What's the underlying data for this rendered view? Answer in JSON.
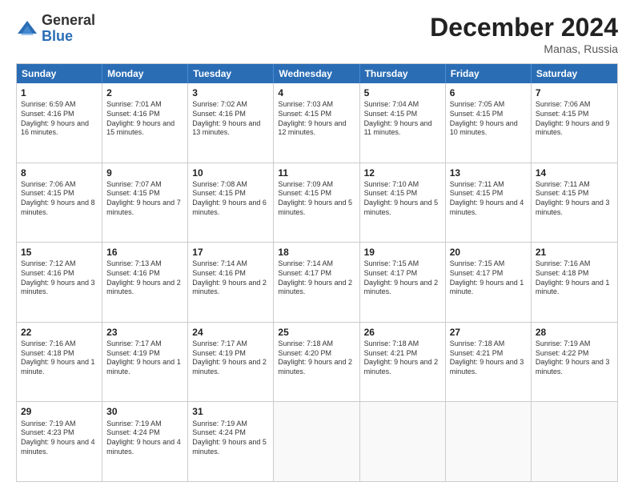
{
  "logo": {
    "general": "General",
    "blue": "Blue"
  },
  "title": "December 2024",
  "location": "Manas, Russia",
  "header_days": [
    "Sunday",
    "Monday",
    "Tuesday",
    "Wednesday",
    "Thursday",
    "Friday",
    "Saturday"
  ],
  "weeks": [
    [
      {
        "day": "1",
        "sunrise": "Sunrise: 6:59 AM",
        "sunset": "Sunset: 4:16 PM",
        "daylight": "Daylight: 9 hours and 16 minutes."
      },
      {
        "day": "2",
        "sunrise": "Sunrise: 7:01 AM",
        "sunset": "Sunset: 4:16 PM",
        "daylight": "Daylight: 9 hours and 15 minutes."
      },
      {
        "day": "3",
        "sunrise": "Sunrise: 7:02 AM",
        "sunset": "Sunset: 4:16 PM",
        "daylight": "Daylight: 9 hours and 13 minutes."
      },
      {
        "day": "4",
        "sunrise": "Sunrise: 7:03 AM",
        "sunset": "Sunset: 4:15 PM",
        "daylight": "Daylight: 9 hours and 12 minutes."
      },
      {
        "day": "5",
        "sunrise": "Sunrise: 7:04 AM",
        "sunset": "Sunset: 4:15 PM",
        "daylight": "Daylight: 9 hours and 11 minutes."
      },
      {
        "day": "6",
        "sunrise": "Sunrise: 7:05 AM",
        "sunset": "Sunset: 4:15 PM",
        "daylight": "Daylight: 9 hours and 10 minutes."
      },
      {
        "day": "7",
        "sunrise": "Sunrise: 7:06 AM",
        "sunset": "Sunset: 4:15 PM",
        "daylight": "Daylight: 9 hours and 9 minutes."
      }
    ],
    [
      {
        "day": "8",
        "sunrise": "Sunrise: 7:06 AM",
        "sunset": "Sunset: 4:15 PM",
        "daylight": "Daylight: 9 hours and 8 minutes."
      },
      {
        "day": "9",
        "sunrise": "Sunrise: 7:07 AM",
        "sunset": "Sunset: 4:15 PM",
        "daylight": "Daylight: 9 hours and 7 minutes."
      },
      {
        "day": "10",
        "sunrise": "Sunrise: 7:08 AM",
        "sunset": "Sunset: 4:15 PM",
        "daylight": "Daylight: 9 hours and 6 minutes."
      },
      {
        "day": "11",
        "sunrise": "Sunrise: 7:09 AM",
        "sunset": "Sunset: 4:15 PM",
        "daylight": "Daylight: 9 hours and 5 minutes."
      },
      {
        "day": "12",
        "sunrise": "Sunrise: 7:10 AM",
        "sunset": "Sunset: 4:15 PM",
        "daylight": "Daylight: 9 hours and 5 minutes."
      },
      {
        "day": "13",
        "sunrise": "Sunrise: 7:11 AM",
        "sunset": "Sunset: 4:15 PM",
        "daylight": "Daylight: 9 hours and 4 minutes."
      },
      {
        "day": "14",
        "sunrise": "Sunrise: 7:11 AM",
        "sunset": "Sunset: 4:15 PM",
        "daylight": "Daylight: 9 hours and 3 minutes."
      }
    ],
    [
      {
        "day": "15",
        "sunrise": "Sunrise: 7:12 AM",
        "sunset": "Sunset: 4:16 PM",
        "daylight": "Daylight: 9 hours and 3 minutes."
      },
      {
        "day": "16",
        "sunrise": "Sunrise: 7:13 AM",
        "sunset": "Sunset: 4:16 PM",
        "daylight": "Daylight: 9 hours and 2 minutes."
      },
      {
        "day": "17",
        "sunrise": "Sunrise: 7:14 AM",
        "sunset": "Sunset: 4:16 PM",
        "daylight": "Daylight: 9 hours and 2 minutes."
      },
      {
        "day": "18",
        "sunrise": "Sunrise: 7:14 AM",
        "sunset": "Sunset: 4:17 PM",
        "daylight": "Daylight: 9 hours and 2 minutes."
      },
      {
        "day": "19",
        "sunrise": "Sunrise: 7:15 AM",
        "sunset": "Sunset: 4:17 PM",
        "daylight": "Daylight: 9 hours and 2 minutes."
      },
      {
        "day": "20",
        "sunrise": "Sunrise: 7:15 AM",
        "sunset": "Sunset: 4:17 PM",
        "daylight": "Daylight: 9 hours and 1 minute."
      },
      {
        "day": "21",
        "sunrise": "Sunrise: 7:16 AM",
        "sunset": "Sunset: 4:18 PM",
        "daylight": "Daylight: 9 hours and 1 minute."
      }
    ],
    [
      {
        "day": "22",
        "sunrise": "Sunrise: 7:16 AM",
        "sunset": "Sunset: 4:18 PM",
        "daylight": "Daylight: 9 hours and 1 minute."
      },
      {
        "day": "23",
        "sunrise": "Sunrise: 7:17 AM",
        "sunset": "Sunset: 4:19 PM",
        "daylight": "Daylight: 9 hours and 1 minute."
      },
      {
        "day": "24",
        "sunrise": "Sunrise: 7:17 AM",
        "sunset": "Sunset: 4:19 PM",
        "daylight": "Daylight: 9 hours and 2 minutes."
      },
      {
        "day": "25",
        "sunrise": "Sunrise: 7:18 AM",
        "sunset": "Sunset: 4:20 PM",
        "daylight": "Daylight: 9 hours and 2 minutes."
      },
      {
        "day": "26",
        "sunrise": "Sunrise: 7:18 AM",
        "sunset": "Sunset: 4:21 PM",
        "daylight": "Daylight: 9 hours and 2 minutes."
      },
      {
        "day": "27",
        "sunrise": "Sunrise: 7:18 AM",
        "sunset": "Sunset: 4:21 PM",
        "daylight": "Daylight: 9 hours and 3 minutes."
      },
      {
        "day": "28",
        "sunrise": "Sunrise: 7:19 AM",
        "sunset": "Sunset: 4:22 PM",
        "daylight": "Daylight: 9 hours and 3 minutes."
      }
    ],
    [
      {
        "day": "29",
        "sunrise": "Sunrise: 7:19 AM",
        "sunset": "Sunset: 4:23 PM",
        "daylight": "Daylight: 9 hours and 4 minutes."
      },
      {
        "day": "30",
        "sunrise": "Sunrise: 7:19 AM",
        "sunset": "Sunset: 4:24 PM",
        "daylight": "Daylight: 9 hours and 4 minutes."
      },
      {
        "day": "31",
        "sunrise": "Sunrise: 7:19 AM",
        "sunset": "Sunset: 4:24 PM",
        "daylight": "Daylight: 9 hours and 5 minutes."
      },
      null,
      null,
      null,
      null
    ]
  ]
}
